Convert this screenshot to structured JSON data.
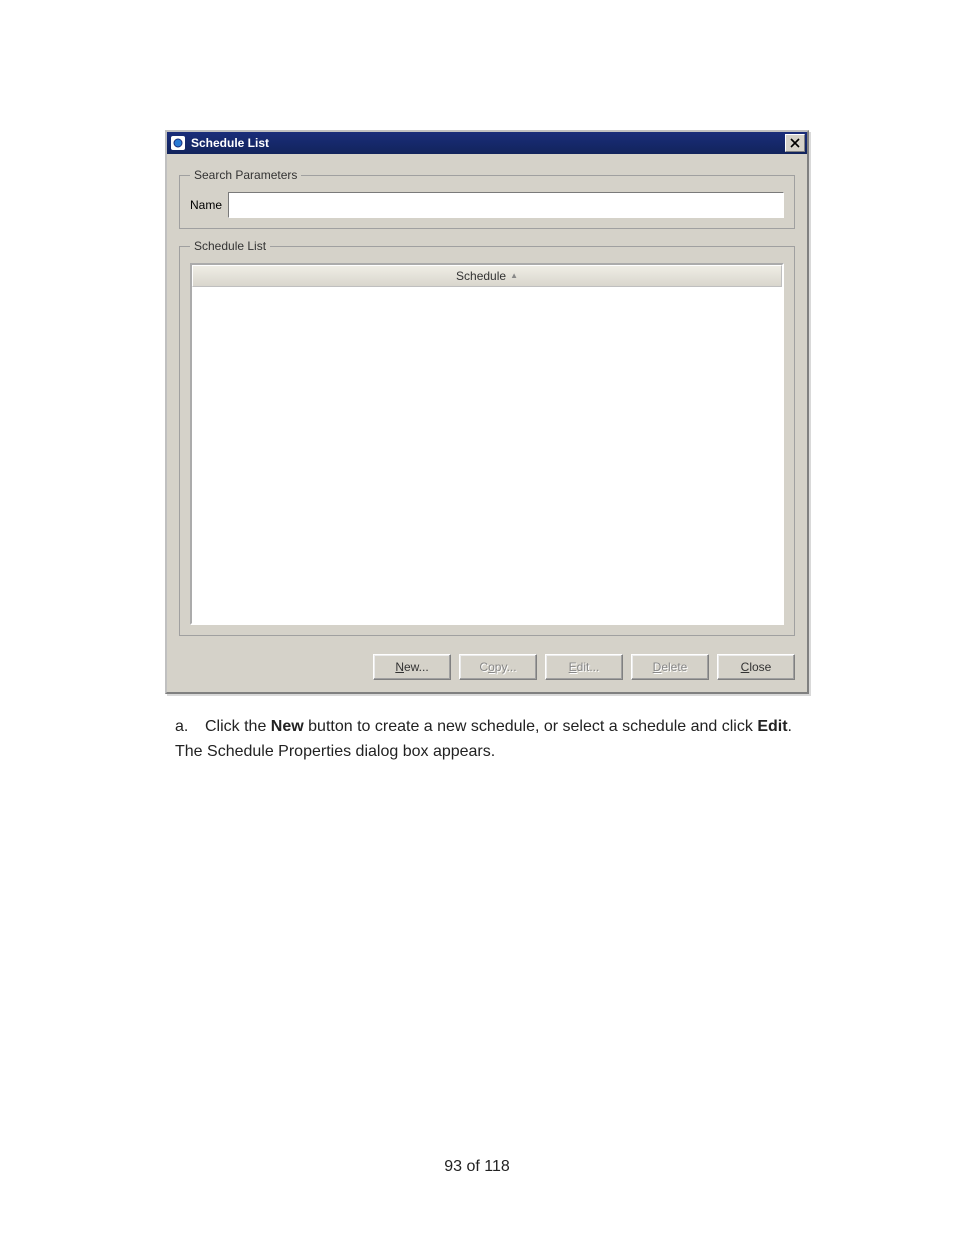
{
  "dialog": {
    "title": "Schedule List",
    "search": {
      "legend": "Search Parameters",
      "name_label": "Name",
      "name_value": ""
    },
    "list": {
      "legend": "Schedule List",
      "column_header": "Schedule",
      "sort_glyph": "▲"
    },
    "buttons": {
      "new": "New...",
      "copy": "Copy...",
      "edit": "Edit...",
      "delete": "Delete",
      "close": "Close",
      "new_enabled": true,
      "copy_enabled": false,
      "edit_enabled": false,
      "delete_enabled": false,
      "close_enabled": true
    }
  },
  "instruction": {
    "marker": "a.",
    "pre": "Click the ",
    "bold1": "New",
    "mid": " button to create a new schedule, or select a schedule and click ",
    "bold2": "Edit",
    "post": ". The Schedule Properties dialog box appears."
  },
  "page_footer": "93 of 118"
}
